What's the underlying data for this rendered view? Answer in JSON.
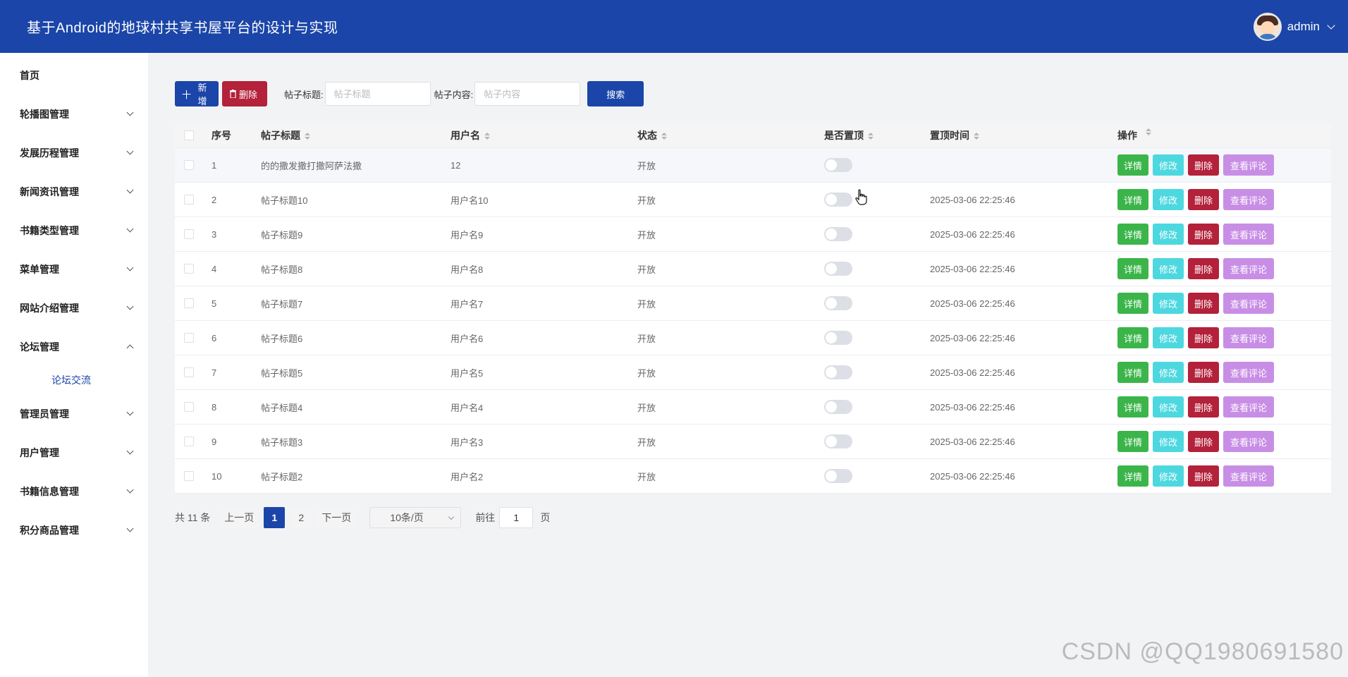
{
  "header": {
    "title": "基于Android的地球村共享书屋平台的设计与实现",
    "username": "admin"
  },
  "sidebar": {
    "items": [
      {
        "label": "首页",
        "expandable": false
      },
      {
        "label": "轮播图管理",
        "expandable": true
      },
      {
        "label": "发展历程管理",
        "expandable": true
      },
      {
        "label": "新闻资讯管理",
        "expandable": true
      },
      {
        "label": "书籍类型管理",
        "expandable": true
      },
      {
        "label": "菜单管理",
        "expandable": true
      },
      {
        "label": "网站介绍管理",
        "expandable": true
      },
      {
        "label": "论坛管理",
        "expandable": true,
        "expanded": true,
        "children": [
          {
            "label": "论坛交流"
          }
        ]
      },
      {
        "label": "管理员管理",
        "expandable": true
      },
      {
        "label": "用户管理",
        "expandable": true
      },
      {
        "label": "书籍信息管理",
        "expandable": true
      },
      {
        "label": "积分商品管理",
        "expandable": true
      }
    ]
  },
  "toolbar": {
    "add_label": "新增",
    "delete_label": "删除",
    "title_label": "帖子标题:",
    "title_placeholder": "帖子标题",
    "content_label": "帖子内容:",
    "content_placeholder": "帖子内容",
    "search_label": "搜索"
  },
  "table": {
    "columns": {
      "idx": "序号",
      "title": "帖子标题",
      "user": "用户名",
      "status": "状态",
      "is_top": "是否置顶",
      "top_time": "置顶时间",
      "ops": "操作"
    },
    "rows": [
      {
        "idx": "1",
        "title": "的的撒发撒打撒阿萨法撒",
        "user": "12",
        "status": "开放",
        "is_top": false,
        "top_time": ""
      },
      {
        "idx": "2",
        "title": "帖子标题10",
        "user": "用户名10",
        "status": "开放",
        "is_top": false,
        "top_time": "2025-03-06 22:25:46"
      },
      {
        "idx": "3",
        "title": "帖子标题9",
        "user": "用户名9",
        "status": "开放",
        "is_top": false,
        "top_time": "2025-03-06 22:25:46"
      },
      {
        "idx": "4",
        "title": "帖子标题8",
        "user": "用户名8",
        "status": "开放",
        "is_top": false,
        "top_time": "2025-03-06 22:25:46"
      },
      {
        "idx": "5",
        "title": "帖子标题7",
        "user": "用户名7",
        "status": "开放",
        "is_top": false,
        "top_time": "2025-03-06 22:25:46"
      },
      {
        "idx": "6",
        "title": "帖子标题6",
        "user": "用户名6",
        "status": "开放",
        "is_top": false,
        "top_time": "2025-03-06 22:25:46"
      },
      {
        "idx": "7",
        "title": "帖子标题5",
        "user": "用户名5",
        "status": "开放",
        "is_top": false,
        "top_time": "2025-03-06 22:25:46"
      },
      {
        "idx": "8",
        "title": "帖子标题4",
        "user": "用户名4",
        "status": "开放",
        "is_top": false,
        "top_time": "2025-03-06 22:25:46"
      },
      {
        "idx": "9",
        "title": "帖子标题3",
        "user": "用户名3",
        "status": "开放",
        "is_top": false,
        "top_time": "2025-03-06 22:25:46"
      },
      {
        "idx": "10",
        "title": "帖子标题2",
        "user": "用户名2",
        "status": "开放",
        "is_top": false,
        "top_time": "2025-03-06 22:25:46"
      }
    ],
    "ops": {
      "detail": "详情",
      "edit": "修改",
      "delete": "删除",
      "comments": "查看评论"
    }
  },
  "pagination": {
    "total": "共 11 条",
    "prev": "上一页",
    "pages": [
      "1",
      "2"
    ],
    "current": "1",
    "next": "下一页",
    "page_size": "10条/页",
    "goto_label": "前往",
    "goto_value": "1",
    "page_unit": "页"
  },
  "watermark": "CSDN @QQ1980691580",
  "colors": {
    "primary": "#1b45a8",
    "danger": "#b3213a",
    "success": "#3bb54a",
    "info": "#4dd8e0",
    "purple": "#c88ee6"
  }
}
